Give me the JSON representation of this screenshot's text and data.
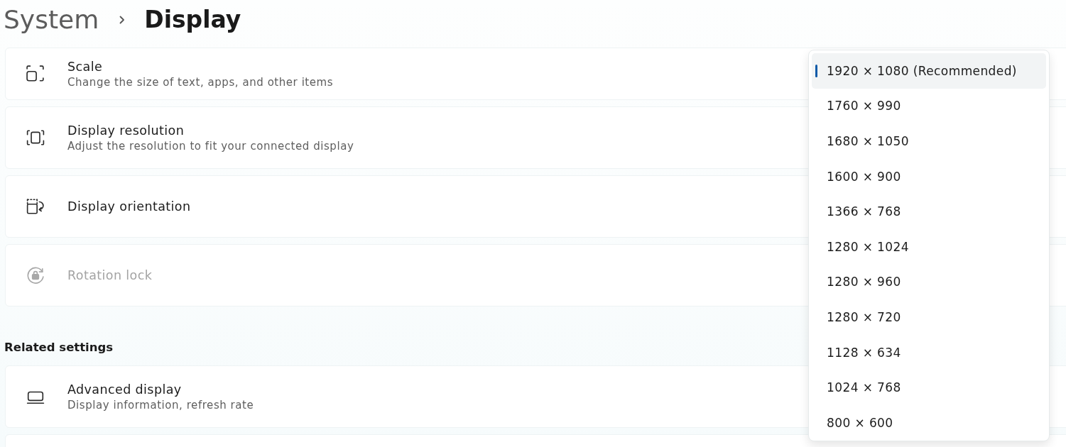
{
  "breadcrumb": {
    "parent": "System",
    "current": "Display"
  },
  "settings": [
    {
      "title": "Scale",
      "description": "Change the size of text, apps, and other items",
      "disabled": false
    },
    {
      "title": "Display resolution",
      "description": "Adjust the resolution to fit your connected display",
      "disabled": false
    },
    {
      "title": "Display orientation",
      "disabled": false
    },
    {
      "title": "Rotation lock",
      "disabled": true
    }
  ],
  "related_settings": {
    "heading": "Related settings",
    "items": [
      {
        "title": "Advanced display",
        "description": "Display information, refresh rate"
      }
    ]
  },
  "resolution_dropdown": {
    "options": [
      {
        "label": "1920 × 1080 (Recommended)",
        "selected": true
      },
      {
        "label": "1760 × 990",
        "selected": false
      },
      {
        "label": "1680 × 1050",
        "selected": false
      },
      {
        "label": "1600 × 900",
        "selected": false
      },
      {
        "label": "1366 × 768",
        "selected": false
      },
      {
        "label": "1280 × 1024",
        "selected": false
      },
      {
        "label": "1280 × 960",
        "selected": false
      },
      {
        "label": "1280 × 720",
        "selected": false
      },
      {
        "label": "1128 × 634",
        "selected": false
      },
      {
        "label": "1024 × 768",
        "selected": false
      },
      {
        "label": "800 × 600",
        "selected": false
      }
    ]
  }
}
